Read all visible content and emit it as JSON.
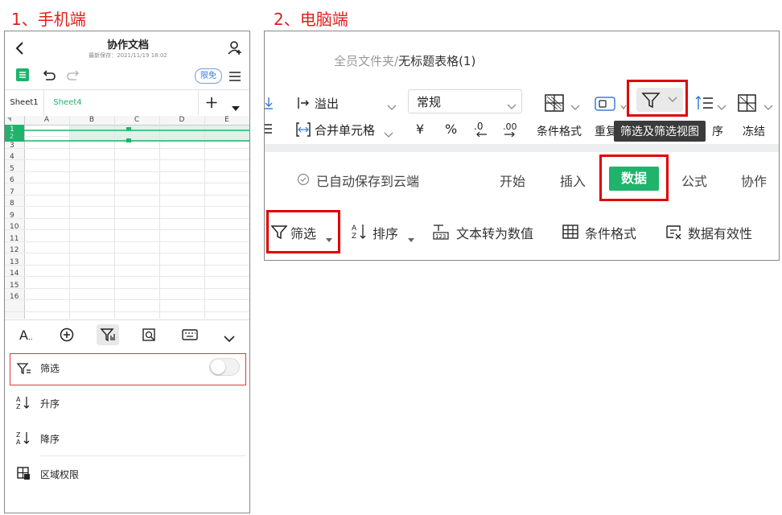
{
  "captions": {
    "mobile": "1、手机端",
    "desktop": "2、电脑端"
  },
  "mobile": {
    "doc_title": "协作文档",
    "last_saved": "最新保存：2021/11/19 18:02",
    "limited_badge": "限免",
    "sheet_tabs": [
      "Sheet1",
      "Sheet4"
    ],
    "columns": [
      "A",
      "B",
      "C",
      "D",
      "E"
    ],
    "rows": [
      "1",
      "2",
      "3",
      "4",
      "5",
      "6",
      "7",
      "8",
      "9",
      "10",
      "11",
      "12",
      "13",
      "14",
      "15",
      "16"
    ],
    "toolbar_icons": [
      "text-format-icon",
      "add-circle-icon",
      "filter-icon",
      "find-icon",
      "keyboard-icon",
      "chevron-down-icon"
    ],
    "menu": [
      {
        "label": "筛选",
        "icon": "filter-icon"
      },
      {
        "label": "升序",
        "icon": "sort-asc-icon"
      },
      {
        "label": "降序",
        "icon": "sort-desc-icon"
      },
      {
        "label": "区域权限",
        "icon": "range-permission-icon"
      }
    ],
    "filter_toggle_on": false,
    "accent": "#1fb36b"
  },
  "desktop": {
    "breadcrumb_root": "全员文件夹/",
    "breadcrumb_file": "无标题表格(1)",
    "overflow_label": "溢出",
    "merge_label": "合并单元格",
    "number_format": "常规",
    "yuan": "¥",
    "percent": "%",
    "conditional_format_label": "条件格式",
    "duplicate_label": "重复",
    "sort_label_partial": "序",
    "freeze_label": "冻结",
    "tooltip": "筛选及筛选视图",
    "autosave": "已自动保存到云端",
    "tabs": [
      "开始",
      "插入",
      "数据",
      "公式",
      "协作"
    ],
    "active_tab": "数据",
    "ribbon": [
      {
        "label": "筛选",
        "icon": "filter-icon"
      },
      {
        "label": "排序",
        "icon": "sort-icon"
      },
      {
        "label": "文本转为数值",
        "icon": "text-to-number-icon"
      },
      {
        "label": "条件格式",
        "icon": "grid-icon"
      },
      {
        "label": "数据有效性",
        "icon": "data-validation-icon"
      }
    ],
    "accent": "#1fb36b"
  }
}
